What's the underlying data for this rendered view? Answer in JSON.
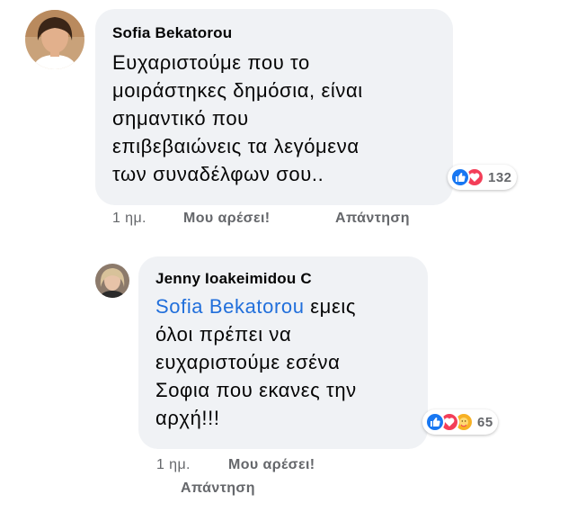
{
  "comments": [
    {
      "author": "Sofia Bekatorou",
      "lines": [
        "Ευχαριστούμε που το",
        "μοιράστηκες δημόσια, είναι",
        "σημαντικό που",
        "επιβεβαιώνεις τα λεγόμενα",
        "των  συναδέλφων σου.."
      ],
      "reactions": {
        "icons": [
          "like-icon",
          "love-icon"
        ],
        "count": "132"
      },
      "time": "1 ημ.",
      "like_label": "Μου αρέσει!",
      "reply_label": "Απάντηση"
    },
    {
      "author": "Jenny Ioakeimidou C",
      "mention": "Sofia Bekatorou",
      "lines": [
        " εμεις",
        "όλοι πρέπει να",
        "ευχαριστούμε εσένα",
        "Σοφια που εκανες την",
        "αρχή!!!"
      ],
      "reactions": {
        "icons": [
          "like-icon",
          "love-icon",
          "care-icon"
        ],
        "count": "65"
      },
      "time": "1 ημ.",
      "like_label": "Μου αρέσει!",
      "reply_label": "Απάντηση"
    }
  ],
  "colors": {
    "bubble": "#f0f2f5",
    "mention": "#216fdb",
    "meta": "#65676b",
    "like": "#1877f2",
    "love": "#f33e58",
    "care": "#f7b125"
  }
}
